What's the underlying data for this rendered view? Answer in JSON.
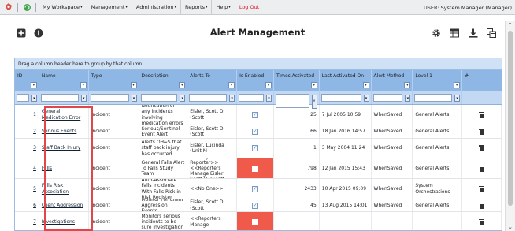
{
  "topbar": {
    "menu": [
      {
        "label": "My Workspace",
        "caret": "▾"
      },
      {
        "label": "Management",
        "caret": "▾"
      },
      {
        "label": "Administration",
        "caret": "▾"
      },
      {
        "label": "Reports",
        "caret": "▾"
      },
      {
        "label": "Help",
        "caret": "▾"
      }
    ],
    "logout": "Log Out",
    "user": "USER: System Manager (Manager)"
  },
  "title": "Alert Management",
  "grid": {
    "group_hint": "Drag a column header here to group by that column",
    "columns": [
      "ID",
      "Name",
      "Type",
      "Description",
      "Alerts To",
      "Is Enabled",
      "Times Activated",
      "Last Activated On",
      "Alert Method",
      "Level 1",
      "#"
    ],
    "rows": [
      {
        "id": "1",
        "name": "General Medication Error",
        "type": "Incident",
        "description": "Notification of any incidents involving medication errors",
        "alerts_to": "Eisler, Scott D. (Scott",
        "enabled": true,
        "times": "25",
        "last": "7 Jul 2005 10:59",
        "method": "WhenSaved",
        "level1": "General Alerts"
      },
      {
        "id": "2",
        "name": "Serious Events",
        "type": "Incident",
        "description": "Serious/Sentinel Event Alert",
        "alerts_to": "Eisler, Scott D. (Scott",
        "enabled": true,
        "times": "66",
        "last": "18 Jan 2016 14:57",
        "method": "WhenSaved",
        "level1": "General Alerts"
      },
      {
        "id": "3",
        "name": "Staff Back Injury",
        "type": "Incident",
        "description": "Alerts OH&S that staff back injury has occurred",
        "alerts_to": "Eisler, Lucinda (Unit M",
        "enabled": true,
        "times": "1",
        "last": "3 May 2004 11:24",
        "method": "WhenSaved",
        "level1": "General Alerts"
      },
      {
        "id": "4",
        "name": "Falls",
        "type": "Incident",
        "description": "General Falls Alert To Falls Study Team",
        "alerts_to": "<<Original Reporter>> <<Reporters Manage Eisler, Scott D. (Scott",
        "enabled": false,
        "times": "798",
        "last": "12 Jan 2015 15:43",
        "method": "WhenSaved",
        "level1": "General Alerts"
      },
      {
        "id": "5",
        "name": "Falls Risk Association",
        "type": "Incident",
        "description": "Auto-Associate Falls Incidents With Falls Risk in Risk Register",
        "alerts_to": "<<No One>>",
        "enabled": true,
        "times": "2433",
        "last": "10 Apr 2015 09:09",
        "method": "WhenSaved",
        "level1": "System Orchestrations"
      },
      {
        "id": "6",
        "name": "Client Aggression",
        "type": "Incident",
        "description": "Monitor For Client Aggression Events",
        "alerts_to": "Eisler, Scott D. (Scott",
        "enabled": true,
        "times": "45",
        "last": "13 Aug 2015 14:01",
        "method": "WhenSaved",
        "level1": "General Alerts"
      },
      {
        "id": "7",
        "name": "Investigations",
        "type": "Incident",
        "description": "Monitors serious incidents to be sure investigation",
        "alerts_to": "<<Reporters Manage",
        "enabled": false,
        "times": "",
        "last": "",
        "method": "",
        "level1": ""
      }
    ]
  },
  "colors": {
    "header": "#8fb7e5",
    "filter": "#c3d9f3",
    "disabled": "#f05a4a",
    "highlight": "#e2454a",
    "logout": "#dd1122"
  }
}
